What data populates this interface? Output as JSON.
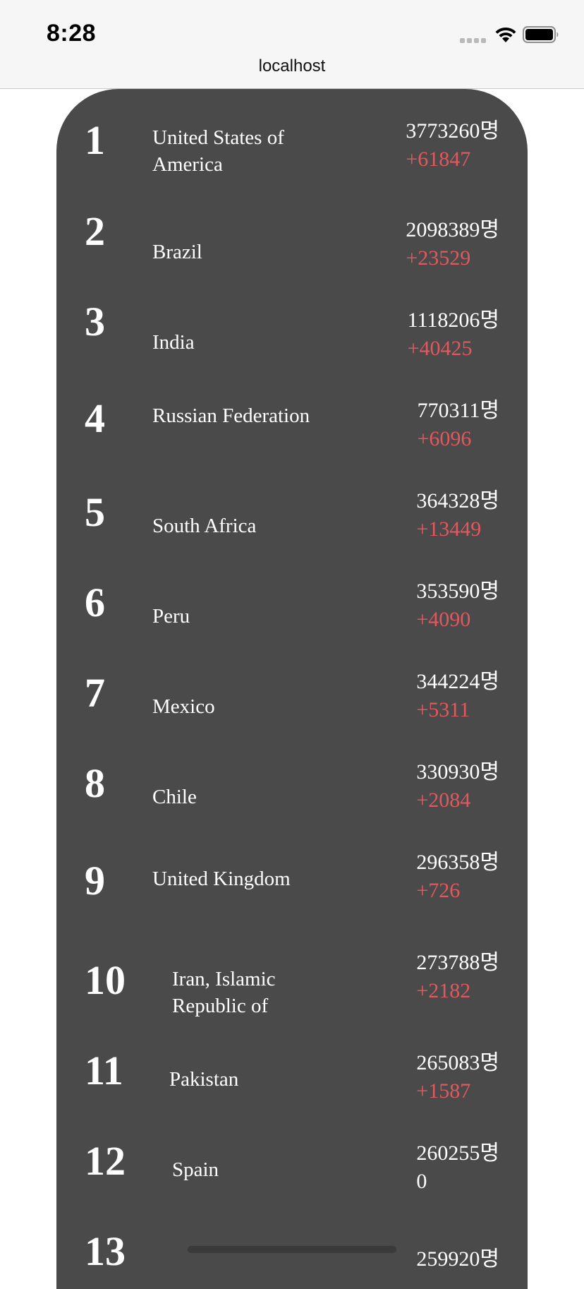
{
  "status_bar": {
    "time": "8:28",
    "url": "localhost"
  },
  "colors": {
    "card_background": "#4a4a4a",
    "delta_color": "#e0595e"
  },
  "rows": [
    {
      "rank": "1",
      "country": "United States of America",
      "total": "3773260명",
      "delta": "+61847"
    },
    {
      "rank": "2",
      "country": "Brazil",
      "total": "2098389명",
      "delta": "+23529"
    },
    {
      "rank": "3",
      "country": "India",
      "total": "1118206명",
      "delta": "+40425"
    },
    {
      "rank": "4",
      "country": "Russian Federation",
      "total": "770311명",
      "delta": "+6096"
    },
    {
      "rank": "5",
      "country": "South Africa",
      "total": "364328명",
      "delta": "+13449"
    },
    {
      "rank": "6",
      "country": "Peru",
      "total": "353590명",
      "delta": "+4090"
    },
    {
      "rank": "7",
      "country": "Mexico",
      "total": "344224명",
      "delta": "+5311"
    },
    {
      "rank": "8",
      "country": "Chile",
      "total": "330930명",
      "delta": "+2084"
    },
    {
      "rank": "9",
      "country": "United Kingdom",
      "total": "296358명",
      "delta": "+726"
    },
    {
      "rank": "10",
      "country": "Iran, Islamic Republic of",
      "total": "273788명",
      "delta": "+2182"
    },
    {
      "rank": "11",
      "country": "Pakistan",
      "total": "265083명",
      "delta": "+1587"
    },
    {
      "rank": "12",
      "country": "Spain",
      "total": "260255명",
      "delta": "0"
    },
    {
      "rank": "13",
      "country": "",
      "total": "259920명",
      "delta": ""
    }
  ]
}
